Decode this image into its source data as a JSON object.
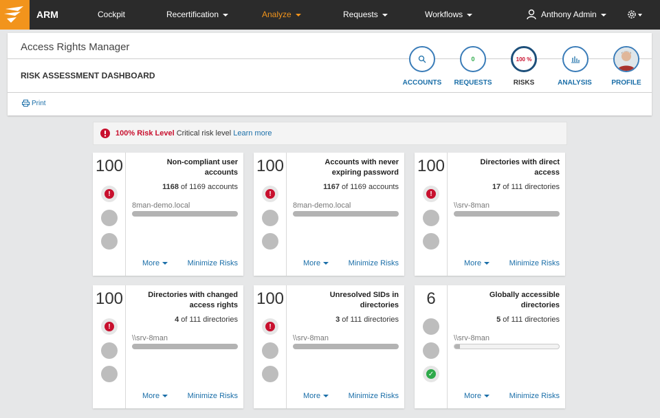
{
  "nav": {
    "brand": "ARM",
    "items": [
      "Cockpit",
      "Recertification",
      "Analyze",
      "Requests",
      "Workflows"
    ],
    "user": "Anthony Admin"
  },
  "header": {
    "app_title": "Access Rights Manager",
    "page_title": "RISK ASSESSMENT DASHBOARD",
    "print": "Print",
    "steps": [
      {
        "label": "ACCOUNTS",
        "icon": "search-icon"
      },
      {
        "label": "REQUESTS",
        "value": "0"
      },
      {
        "label": "RISKS",
        "value": "100 %"
      },
      {
        "label": "ANALYSIS",
        "icon": "bar-chart-icon"
      },
      {
        "label": "PROFILE",
        "icon": "avatar"
      }
    ]
  },
  "banner": {
    "level": "100%",
    "level_label": "Risk Level",
    "text": "Critical risk level",
    "link": "Learn more"
  },
  "cards": [
    {
      "score": "100",
      "title": "Non-compliant user accounts",
      "count": "1168",
      "count_rest": " of 1169 accounts",
      "source": "8man-demo.local",
      "progress": 0.999,
      "status": "critical",
      "more": "More",
      "minimize": "Minimize Risks"
    },
    {
      "score": "100",
      "title": "Accounts with never expiring password",
      "count": "1167",
      "count_rest": " of 1169 accounts",
      "source": "8man-demo.local",
      "progress": 0.998,
      "status": "critical",
      "more": "More",
      "minimize": "Minimize Risks"
    },
    {
      "score": "100",
      "title": "Directories with direct access",
      "count": "17",
      "count_rest": " of 111 directories",
      "source": "\\\\srv-8man",
      "progress": 1.0,
      "status": "critical",
      "more": "More",
      "minimize": "Minimize Risks"
    },
    {
      "score": "100",
      "title": "Directories with changed access rights",
      "count": "4",
      "count_rest": " of 111 directories",
      "source": "\\\\srv-8man",
      "progress": 1.0,
      "status": "critical",
      "more": "More",
      "minimize": "Minimize Risks"
    },
    {
      "score": "100",
      "title": "Unresolved SIDs in directories",
      "count": "3",
      "count_rest": " of 111 directories",
      "source": "\\\\srv-8man",
      "progress": 1.0,
      "status": "critical",
      "more": "More",
      "minimize": "Minimize Risks"
    },
    {
      "score": "6",
      "title": "Globally accessible directories",
      "count": "5",
      "count_rest": " of 111 directories",
      "source": "\\\\srv-8man",
      "progress": 0.05,
      "status": "ok",
      "more": "More",
      "minimize": "Minimize Risks"
    }
  ],
  "colors": {
    "accent": "#f2941c",
    "link": "#1a6ea8",
    "critical": "#c8102e",
    "ok": "#2eaa4a"
  }
}
